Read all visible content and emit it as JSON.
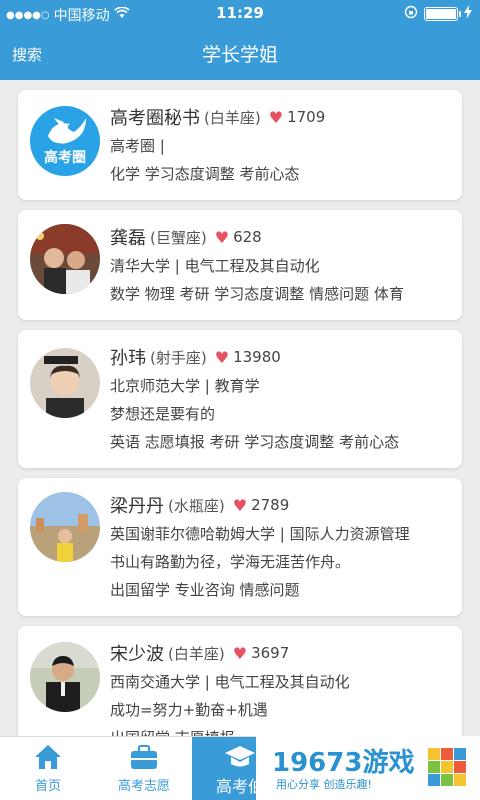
{
  "status_bar": {
    "carrier": "中国移动",
    "time": "11:29"
  },
  "nav": {
    "search": "搜索",
    "title": "学长学姐"
  },
  "avatar_logo_text": "高考圈",
  "cards": [
    {
      "name": "高考圈秘书",
      "sign": "(白羊座)",
      "likes": "1709",
      "line1": "高考圈 |",
      "line2": "化学 学习态度调整 考前心态",
      "line3": ""
    },
    {
      "name": "龚磊",
      "sign": "(巨蟹座)",
      "likes": "628",
      "line1": "清华大学 | 电气工程及其自动化",
      "line2": "数学 物理 考研 学习态度调整 情感问题 体育",
      "line3": ""
    },
    {
      "name": "孙玮",
      "sign": "(射手座)",
      "likes": "13980",
      "line1": "北京师范大学 | 教育学",
      "line2": "梦想还是要有的",
      "line3": "英语 志愿填报 考研 学习态度调整 考前心态"
    },
    {
      "name": "梁丹丹",
      "sign": "(水瓶座)",
      "likes": "2789",
      "line1": "英国谢菲尔德哈勒姆大学 | 国际人力资源管理",
      "line2": "书山有路勤为径，学海无涯苦作舟。",
      "line3": "出国留学 专业咨询 情感问题"
    },
    {
      "name": "宋少波",
      "sign": "(白羊座)",
      "likes": "3697",
      "line1": "西南交通大学 | 电气工程及其自动化",
      "line2": "成功=努力+勤奋+机遇",
      "line3": "出国留学 志愿填报 "
    }
  ],
  "tabs": [
    {
      "label": "首页",
      "icon": "home-icon"
    },
    {
      "label": "高考志愿",
      "icon": "briefcase-icon"
    },
    {
      "label": "高考伯",
      "icon": "graduation-cap-icon"
    }
  ],
  "watermark": {
    "text": "19673游戏",
    "sub": "用心分享  创造乐趣!"
  },
  "colors": {
    "brand": "#3a9bd9",
    "heart": "#e7505f"
  }
}
